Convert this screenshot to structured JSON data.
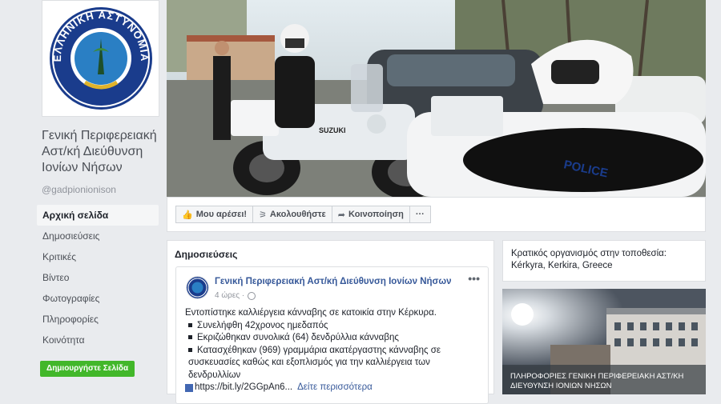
{
  "page": {
    "name": "Γενική Περιφερειακή Αστ/κή Διεύθυνση Ιονίων Νήσων",
    "handle": "@gadpionionison",
    "logo_text": "ΕΛΛΗΝΙΚΗ ΑΣΤΥΝΟΜΙΑ"
  },
  "cover": {
    "motorcycle_brand": "SUZUKI",
    "police_text": "POLICE"
  },
  "nav": {
    "items": [
      {
        "label": "Αρχική σελίδα",
        "active": true
      },
      {
        "label": "Δημοσιεύσεις"
      },
      {
        "label": "Κριτικές"
      },
      {
        "label": "Βίντεο"
      },
      {
        "label": "Φωτογραφίες"
      },
      {
        "label": "Πληροφορίες"
      },
      {
        "label": "Κοινότητα"
      }
    ],
    "create_page": "Δημιουργήστε Σελίδα"
  },
  "actions": {
    "like": "Μου αρέσει!",
    "follow": "Ακολουθήστε",
    "share": "Κοινοποίηση",
    "more": "···"
  },
  "posts": {
    "title": "Δημοσιεύσεις",
    "item": {
      "author": "Γενική Περιφερειακή Αστ/κή Διεύθυνση Ιονίων Νήσων",
      "time": "4 ώρες ·",
      "more": "•••",
      "intro": "Εντοπίστηκε καλλιέργεια κάνναβης σε κατοικία στην Κέρκυρα.",
      "bullets": [
        "Συνελήφθη 42χρονος ημεδαπός",
        "Εκριζώθηκαν συνολικά (64) δενδρύλλια κάνναβης",
        "Κατασχέθηκαν (969) γραμμάρια ακατέργαστης κάνναβης σε συσκευασίες καθώς και εξοπλισμός για την καλλιέργεια των δενδρυλλίων"
      ],
      "link": "https://bit.ly/2GGpAn6...",
      "see_more": "Δείτε περισσότερα"
    }
  },
  "info": {
    "text": "Κρατικός οργανισμός στην τοποθεσία: Kérkyra, Kerkira, Greece"
  },
  "photo": {
    "caption": "ΠΛΗΡΟΦΟΡΙΕΣ ΓΕΝΙΚΗ ΠΕΡΙΦΕΡΕΙΑΚΗ ΑΣΤ/ΚΗ ΔΙΕΥΘΥΝΣΗ ΙΟΝΙΩΝ ΝΗΣΩΝ"
  }
}
